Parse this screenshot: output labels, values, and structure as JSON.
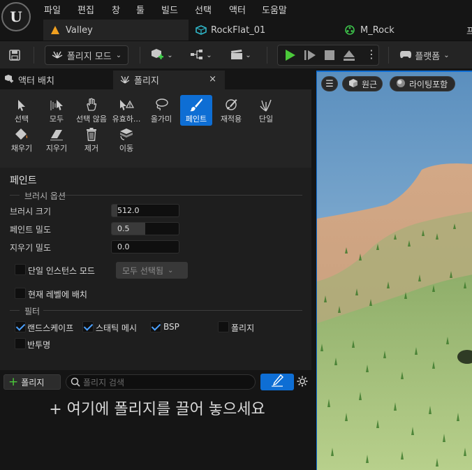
{
  "app": {
    "logo_text": "U"
  },
  "menu": [
    "파일",
    "편집",
    "창",
    "툴",
    "빌드",
    "선택",
    "액터",
    "도움말"
  ],
  "doc_tabs": [
    {
      "label": "Valley",
      "icon": "level-icon"
    },
    {
      "label": "RockFlat_01",
      "icon": "static-mesh-icon"
    },
    {
      "label": "M_Rock",
      "icon": "material-icon"
    },
    {
      "label": "프"
    }
  ],
  "toolbar": {
    "mode_label": "폴리지 모드",
    "platform_label": "플랫폼"
  },
  "panel_tabs": [
    {
      "label": "액터 배치"
    },
    {
      "label": "폴리지"
    }
  ],
  "tools": [
    {
      "label": "선택",
      "icon": "arrow-cursor-icon"
    },
    {
      "label": "모두",
      "icon": "select-all-icon"
    },
    {
      "label": "선택 않음",
      "icon": "deselect-icon"
    },
    {
      "label": "유효하...",
      "icon": "select-invalid-icon"
    },
    {
      "label": "올가미",
      "icon": "lasso-icon"
    },
    {
      "label": "페인트",
      "icon": "paint-brush-icon"
    },
    {
      "label": "재적용",
      "icon": "reapply-icon"
    },
    {
      "label": "단일",
      "icon": "single-foliage-icon"
    },
    {
      "label": "채우기",
      "icon": "fill-bucket-icon"
    },
    {
      "label": "지우기",
      "icon": "eraser-icon"
    },
    {
      "label": "제거",
      "icon": "trash-icon"
    },
    {
      "label": "이동",
      "icon": "move-to-level-icon"
    }
  ],
  "paint": {
    "title": "페인트",
    "brush_group": "브러시 옵션",
    "brush_size_label": "브러시 크기",
    "brush_size_value": "512.0",
    "paint_density_label": "페인트 밀도",
    "paint_density_value": "0.5",
    "erase_density_label": "지우기 밀도",
    "erase_density_value": "0.0",
    "single_instance_label": "단일 인스턴스 모드",
    "select_mode_value": "모두 선택됨",
    "current_level_label": "현재 레벨에 배치",
    "filter_group": "필터",
    "filters": [
      {
        "label": "랜드스케이프",
        "checked": true
      },
      {
        "label": "스태틱 메시",
        "checked": true
      },
      {
        "label": "BSP",
        "checked": true
      },
      {
        "label": "폴리지",
        "checked": false
      },
      {
        "label": "반투명",
        "checked": false
      }
    ]
  },
  "foliage_list": {
    "add_label": "폴리지",
    "search_placeholder": "폴리지 검색",
    "drop_hint": "+ 여기에 폴리지를 끌어 놓으세요"
  },
  "viewport": {
    "perspective_label": "원근",
    "lighting_label": "라이팅포함"
  }
}
